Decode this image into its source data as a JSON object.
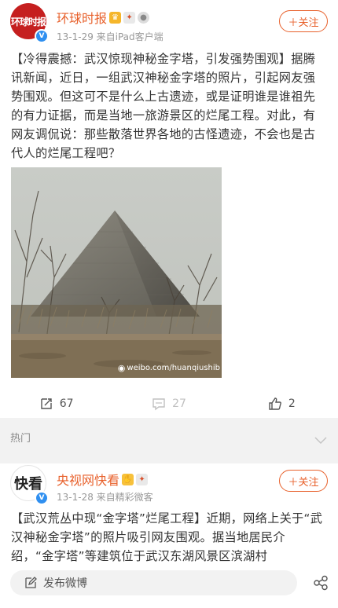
{
  "post1": {
    "avatar_text": "环球时报",
    "author": "环球时报",
    "badges": [
      "crown-badge",
      "medal-badge",
      "silver-badge"
    ],
    "meta": "13-1-29  来自iPad客户端",
    "follow_label": "＋关注",
    "text": "【冷得震撼：武汉惊现神秘金字塔，引发强势围观】据腾讯新闻，近日，一组武汉神秘金字塔的照片，引起网友强势围观。但这可不是什么上古遗迹，或是证明谁是谁祖先的有力证据，而是当地一旅游景区的烂尾工程。对此，有网友调侃说：那些散落世界各地的古怪遗迹，不会也是古代人的烂尾工程吧？",
    "image_watermark": "weibo.com/huanqiushib",
    "actions": {
      "repost_count": "67",
      "comment_count": "27",
      "like_count": "2"
    }
  },
  "section": {
    "hot_label": "热门"
  },
  "post2": {
    "avatar_text": "快看",
    "author": "央视网快看",
    "badges": [
      "hand-badge",
      "medal-badge"
    ],
    "meta": "13-1-28  来自精彩微客",
    "follow_label": "＋关注",
    "text": "【武汉荒丛中现“金字塔”烂尾工程】近期，网络上关于“武汉神秘金字塔”的照片吸引网友围观。据当地居民介绍，“金字塔”等建筑位于武汉东湖风景区滨湖村"
  },
  "compose": {
    "placeholder": "发布微博"
  },
  "colors": {
    "accent": "#e8612c",
    "verified": "#2f8ff0",
    "divider": "#f2f2f2"
  }
}
